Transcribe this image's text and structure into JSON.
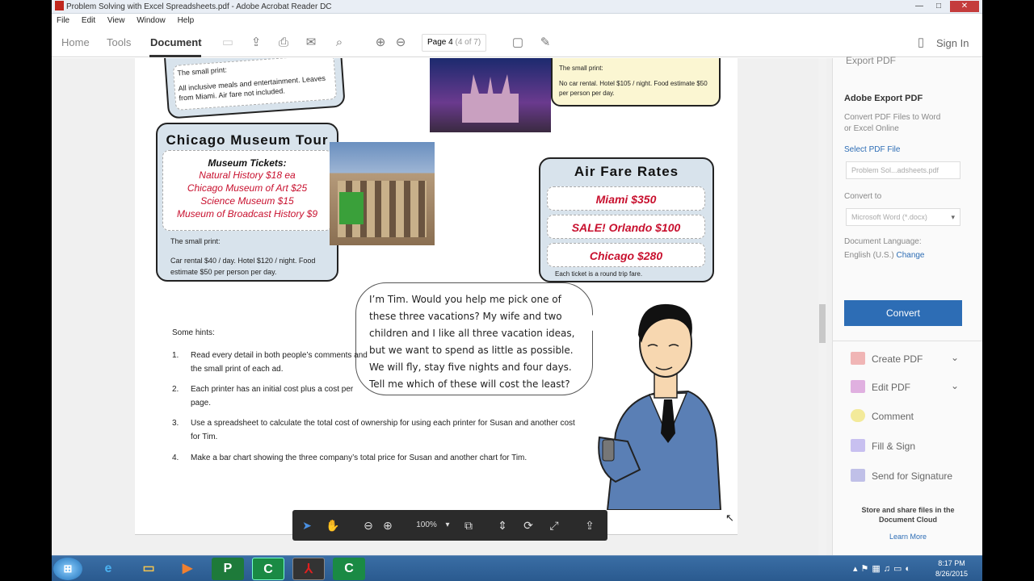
{
  "window": {
    "title": "Problem Solving with Excel Spreadsheets.pdf - Adobe Acrobat Reader DC",
    "min": "—",
    "max": "□",
    "close": "✕"
  },
  "menu": [
    "File",
    "Edit",
    "View",
    "Window",
    "Help"
  ],
  "tabs": {
    "home": "Home",
    "tools": "Tools",
    "document": "Document"
  },
  "toolbar": {
    "page_label": "Page 4",
    "page_count": "(4 of 7)",
    "sign_in": "Sign In"
  },
  "disney": {
    "small_print_heading": "The small print:",
    "small_print": "All inclusive meals and entertainment. Leaves from Miami. Air fare not included."
  },
  "orlando_card": {
    "small_print_heading": "The small print:",
    "small_print": "No car rental. Hotel $105 / night. Food estimate $50 per person per day."
  },
  "chicago": {
    "title": "Chicago Museum Tour",
    "tickets_heading": "Museum Tickets:",
    "tickets": [
      "Natural History $18 ea",
      "Chicago Museum of Art $25",
      "Science Museum $15",
      "Museum of Broadcast History $9"
    ],
    "small_print_heading": "The small print:",
    "small_print": "Car rental $40 / day. Hotel $120 / night. Food estimate $50 per person per day."
  },
  "airfare": {
    "title": "Air Fare Rates",
    "rates": [
      "Miami $350",
      "SALE! Orlando $100",
      "Chicago $280"
    ],
    "note": "Each ticket is a round trip fare."
  },
  "speech": "I’m Tim. Would you help me pick one of these three vacations? My wife and two children and I like all three vacation ideas, but we want to spend as little as possible. We will fly, stay five nights and four days. Tell me which of these will cost the least?",
  "hints": {
    "heading": "Some hints:",
    "items": [
      {
        "num": "1.",
        "text": "Read every detail in both people’s comments and the small print of each ad."
      },
      {
        "num": "2.",
        "text": "Each printer has an initial cost plus a cost per page."
      },
      {
        "num": "3.",
        "text": "Use a spreadsheet to calculate the total cost of ownership for using each printer for Susan and another cost for Tim."
      },
      {
        "num": "4.",
        "text": "Make a bar chart showing the three company’s total price for Susan and another chart for Tim."
      }
    ]
  },
  "zoom": "100%",
  "right_panel": {
    "export_header": "Export PDF",
    "title": "Adobe Export PDF",
    "desc": "Convert PDF Files to Word or Excel Online",
    "select_label": "Select PDF File",
    "file_value": "Problem Sol...adsheets.pdf",
    "convert_to_label": "Convert to",
    "convert_to_value": "Microsoft Word (*.docx)",
    "lang_label": "Document Language:",
    "lang_value": "English (U.S.)",
    "change_link": "Change",
    "convert_button": "Convert",
    "tools": [
      "Create PDF",
      "Edit PDF",
      "Comment",
      "Fill & Sign",
      "Send for Signature"
    ],
    "store_text": "Store and share files in the Document Cloud",
    "learn_more": "Learn More"
  },
  "taskbar": {
    "time": "8:17 PM",
    "date": "8/26/2015"
  },
  "colors": {
    "accent": "#2d6db5",
    "red": "#c8102e",
    "card_bg": "#d8e3ec"
  }
}
